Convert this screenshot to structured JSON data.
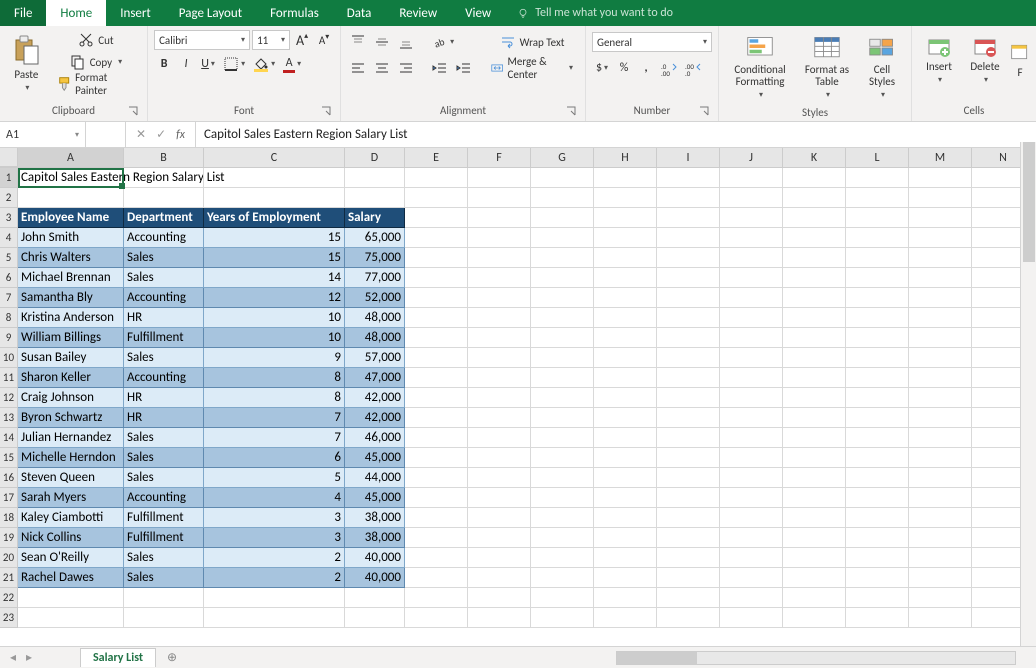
{
  "tabs": {
    "file": "File",
    "home": "Home",
    "insert": "Insert",
    "pageLayout": "Page Layout",
    "formulas": "Formulas",
    "data": "Data",
    "review": "Review",
    "view": "View",
    "tellMe": "Tell me what you want to do"
  },
  "ribbon": {
    "clipboard": {
      "paste": "Paste",
      "cut": "Cut",
      "copy": "Copy",
      "formatPainter": "Format Painter",
      "label": "Clipboard"
    },
    "font": {
      "name": "Calibri",
      "size": "11",
      "label": "Font",
      "increase": "A",
      "decrease": "A",
      "bold": "B",
      "italic": "I",
      "underline": "U"
    },
    "alignment": {
      "wrapText": "Wrap Text",
      "mergeCenter": "Merge & Center",
      "label": "Alignment"
    },
    "number": {
      "format": "General",
      "label": "Number"
    },
    "styles": {
      "conditional": "Conditional Formatting",
      "formatAsTable": "Format as Table",
      "cellStyles": "Cell Styles",
      "label": "Styles"
    },
    "cells": {
      "insert": "Insert",
      "delete": "Delete",
      "format": "F",
      "label": "Cells"
    }
  },
  "nameBox": "A1",
  "formulaBar": "Capitol Sales Eastern Region Salary List",
  "columns": [
    "A",
    "B",
    "C",
    "D",
    "E",
    "F",
    "G",
    "H",
    "I",
    "J",
    "K",
    "L",
    "M",
    "N"
  ],
  "columnClasses": [
    "cA",
    "cB",
    "cC",
    "cD",
    "cE",
    "cF",
    "cG",
    "cH",
    "cI",
    "cJ",
    "cK",
    "cL",
    "cM",
    "cN"
  ],
  "rowCount": 23,
  "title": "Capitol Sales Eastern Region Salary List",
  "tableHeaders": [
    "Employee Name",
    "Department",
    "Years of Employment",
    "Salary"
  ],
  "tableRows": [
    {
      "name": "John Smith",
      "dept": "Accounting",
      "years": "15",
      "salary": "65,000"
    },
    {
      "name": "Chris Walters",
      "dept": "Sales",
      "years": "15",
      "salary": "75,000"
    },
    {
      "name": "Michael Brennan",
      "dept": "Sales",
      "years": "14",
      "salary": "77,000"
    },
    {
      "name": "Samantha Bly",
      "dept": "Accounting",
      "years": "12",
      "salary": "52,000"
    },
    {
      "name": "Kristina Anderson",
      "dept": "HR",
      "years": "10",
      "salary": "48,000"
    },
    {
      "name": "William Billings",
      "dept": "Fulfillment",
      "years": "10",
      "salary": "48,000"
    },
    {
      "name": "Susan Bailey",
      "dept": "Sales",
      "years": "9",
      "salary": "57,000"
    },
    {
      "name": "Sharon Keller",
      "dept": "Accounting",
      "years": "8",
      "salary": "47,000"
    },
    {
      "name": "Craig Johnson",
      "dept": "HR",
      "years": "8",
      "salary": "42,000"
    },
    {
      "name": "Byron Schwartz",
      "dept": "HR",
      "years": "7",
      "salary": "42,000"
    },
    {
      "name": "Julian Hernandez",
      "dept": "Sales",
      "years": "7",
      "salary": "46,000"
    },
    {
      "name": "Michelle Herndon",
      "dept": "Sales",
      "years": "6",
      "salary": "45,000"
    },
    {
      "name": "Steven Queen",
      "dept": "Sales",
      "years": "5",
      "salary": "44,000"
    },
    {
      "name": "Sarah Myers",
      "dept": "Accounting",
      "years": "4",
      "salary": "45,000"
    },
    {
      "name": "Kaley Ciambotti",
      "dept": "Fulfillment",
      "years": "3",
      "salary": "38,000"
    },
    {
      "name": "Nick Collins",
      "dept": "Fulfillment",
      "years": "3",
      "salary": "38,000"
    },
    {
      "name": "Sean O'Reilly",
      "dept": "Sales",
      "years": "2",
      "salary": "40,000"
    },
    {
      "name": "Rachel Dawes",
      "dept": "Sales",
      "years": "2",
      "salary": "40,000"
    }
  ],
  "sheetTab": "Salary List"
}
